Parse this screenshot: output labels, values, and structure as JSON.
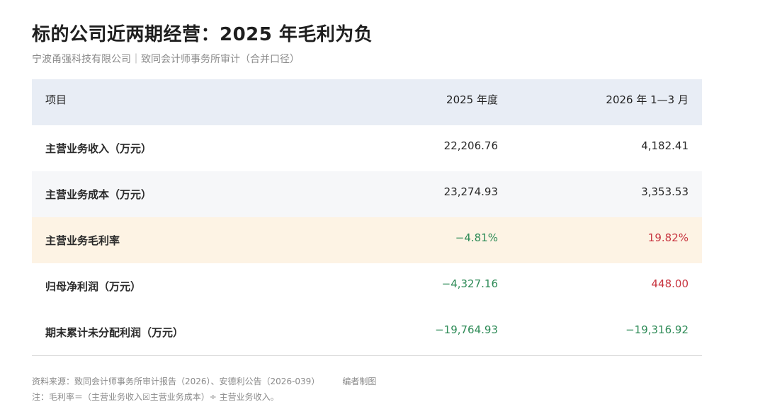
{
  "title": "标的公司近两期经营：2025 年毛利为负",
  "subtitle": "宁波甬强科技有限公司｜致同会计师事务所审计（合并口径）",
  "table": {
    "headers": [
      "项目",
      "2025 年度",
      "2026 年 1—3 月"
    ],
    "rows": [
      {
        "label": "主营业务收入（万元）",
        "v2025": "22,206.76",
        "v2026": "4,182.41"
      },
      {
        "label": "主营业务成本（万元）",
        "v2025": "23,274.93",
        "v2026": "3,353.53"
      },
      {
        "label": "主营业务毛利率",
        "v2025": "−4.81%",
        "v2026": "19.82%"
      },
      {
        "label": "归母净利润（万元）",
        "v2025": "−4,327.16",
        "v2026": "448.00"
      },
      {
        "label": "期末累计未分配利润（万元）",
        "v2025": "−19,764.93",
        "v2026": "−19,316.92"
      }
    ]
  },
  "footer": {
    "source": "资料来源：致同会计师事务所审计报告（2026）、安德利公告（2026-039）",
    "author": "编者制图",
    "note": "注：毛利率＝（主营业务收入☒主营业务成本）÷ 主营业务收入。"
  },
  "colors": {
    "header_bg": "#e8edf5",
    "highlight_bg": "#fdf3e4",
    "negative": "#2e8b57",
    "positive": "#c8343f"
  }
}
